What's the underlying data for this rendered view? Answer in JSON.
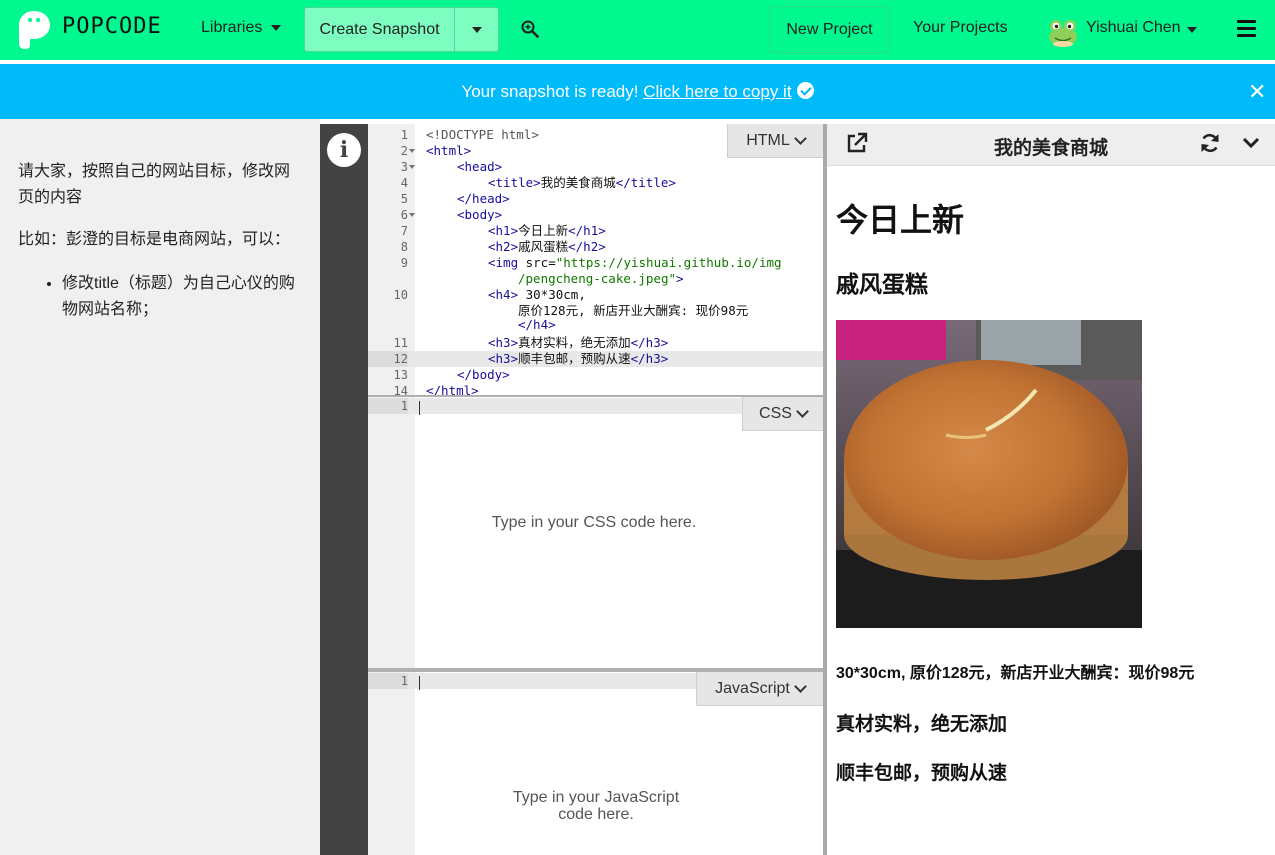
{
  "navbar": {
    "brand": "POPCODE",
    "libraries_label": "Libraries",
    "create_snapshot_label": "Create Snapshot",
    "new_project_label": "New Project",
    "your_projects_label": "Your Projects",
    "user_name": "Yishuai Chen",
    "accent_color": "#00f88e"
  },
  "notification": {
    "text": "Your snapshot is ready!",
    "link_text": "Click here to copy it",
    "color": "#00bbf9"
  },
  "instructions": {
    "para1": "请大家，按照自己的网站目标，修改网页的内容",
    "para2": "比如：彭澄的目标是电商网站，可以：",
    "bullet1": "修改title（标题）为自己心仪的购物网站名称；"
  },
  "editors": {
    "html_label": "HTML",
    "css_label": "CSS",
    "js_label": "JavaScript",
    "css_placeholder": "Type in your CSS code here.",
    "js_placeholder_line1": "Type in your JavaScript",
    "js_placeholder_line2": "code here.",
    "html_line_numbers": [
      "1",
      "2",
      "3",
      "4",
      "5",
      "6",
      "7",
      "8",
      "9",
      "10",
      "11",
      "12",
      "13",
      "14"
    ],
    "css_line_numbers": [
      "1"
    ],
    "js_line_numbers": [
      "1"
    ],
    "active_line": 12
  },
  "html_code": {
    "l1_doctype": "<!DOCTYPE html>",
    "l2_open": "<html>",
    "l3_head": "<head>",
    "l4_title_open": "<title>",
    "l4_title_text": "我的美食商城",
    "l4_title_close": "</title>",
    "l5_head_close": "</head>",
    "l6_body": "<body>",
    "l7_h1_open": "<h1>",
    "l7_h1_text": "今日上新",
    "l7_h1_close": "</h1>",
    "l8_h2_open": "<h2>",
    "l8_h2_text": "戚风蛋糕",
    "l8_h2_close": "</h2>",
    "l9_img_open": "<img",
    "l9_attr": " src=",
    "l9_src_a": "\"https://yishuai.github.io/img",
    "l9_src_b": "/pengcheng-cake.jpeg\"",
    "l9_close": ">",
    "l10_h4_open": "<h4>",
    "l10_text_a": " 30*30cm,",
    "l10_text_b": "原价128元, 新店开业大酬宾: 现价98元",
    "l10_h4_close": "</h4>",
    "l11_h3_open": "<h3>",
    "l11_text": "真材实料，绝无添加",
    "l11_h3_close": "</h3>",
    "l12_h3_open": "<h3>",
    "l12_text": "顺丰包邮，预购从速",
    "l12_h3_close": "</h3>",
    "l13_body_close": "</body>",
    "l14_html_close": "</html>"
  },
  "preview": {
    "title": "我的美食商城",
    "h1": "今日上新",
    "h2": "戚风蛋糕",
    "h4": "30*30cm, 原价128元，新店开业大酬宾：现价98元",
    "h3a": "真材实料，绝无添加",
    "h3b": "顺丰包邮，预购从速"
  },
  "icons": [
    "popcode-logo-icon",
    "caret-down-icon",
    "zoom-in-icon",
    "avatar-frog-icon",
    "hamburger-icon",
    "check-circle-icon",
    "close-icon",
    "info-icon",
    "chevron-down-icon",
    "popout-icon",
    "refresh-icon"
  ]
}
